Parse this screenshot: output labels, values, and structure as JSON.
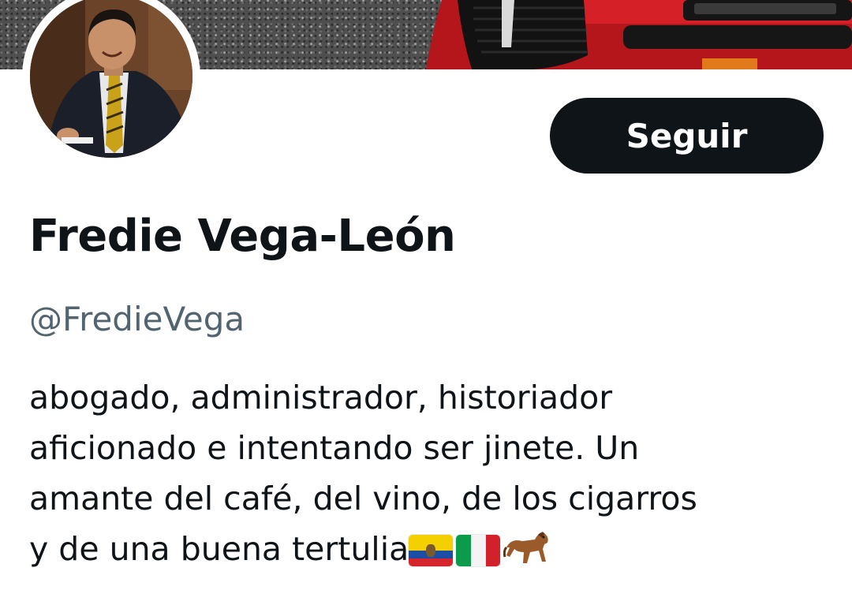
{
  "profile": {
    "display_name": "Fredie Vega-León",
    "handle": "@FredieVega",
    "bio_lines": [
      "abogado, administrador, historiador",
      "aficionado e intentando ser jinete. Un",
      "amante del café, del vino, de los cigarros",
      "y de una buena tertulia"
    ],
    "bio_emojis": [
      "flag-ecuador-icon",
      "flag-italy-icon",
      "horse-icon"
    ]
  },
  "actions": {
    "follow_label": "Seguir"
  },
  "colors": {
    "text_primary": "#0f1419",
    "text_secondary": "#536471",
    "button_bg": "#0f1419",
    "button_text": "#ffffff",
    "banner_car": "#c8191e"
  }
}
